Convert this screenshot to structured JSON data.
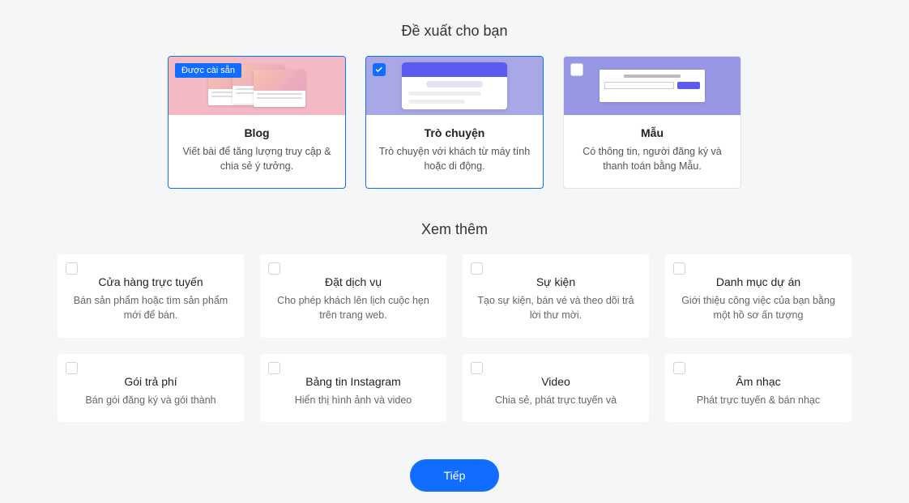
{
  "recommended": {
    "heading": "Đề xuất cho bạn",
    "cards": [
      {
        "title": "Blog",
        "desc": "Viết bài để tăng lượng truy cập & chia sẻ ý tưởng.",
        "installed_label": "Được cài sẵn"
      },
      {
        "title": "Trò chuyện",
        "desc": "Trò chuyện với khách từ máy tính hoặc di động."
      },
      {
        "title": "Mẫu",
        "desc": "Có thông tin, người đăng ký và thanh toán bằng Mẫu."
      }
    ]
  },
  "more": {
    "heading": "Xem thêm",
    "cards": [
      {
        "title": "Cửa hàng trực tuyến",
        "desc": "Bán sản phẩm hoặc tìm sản phẩm mới để bán."
      },
      {
        "title": "Đặt dịch vụ",
        "desc": "Cho phép khách lên lịch cuộc hẹn trên trang web."
      },
      {
        "title": "Sự kiện",
        "desc": "Tạo sự kiện, bán vé và theo dõi trả lời thư mời."
      },
      {
        "title": "Danh mục dự án",
        "desc": "Giới thiệu công việc của bạn bằng một hồ sơ ấn tượng"
      },
      {
        "title": "Gói trả phí",
        "desc": "Bán gói đăng ký và gói thành"
      },
      {
        "title": "Bảng tin Instagram",
        "desc": "Hiển thị hình ảnh và video"
      },
      {
        "title": "Video",
        "desc": "Chia sẻ, phát trực tuyến và"
      },
      {
        "title": "Âm nhạc",
        "desc": "Phát trực tuyến & bán nhạc"
      }
    ]
  },
  "next_button": "Tiếp"
}
